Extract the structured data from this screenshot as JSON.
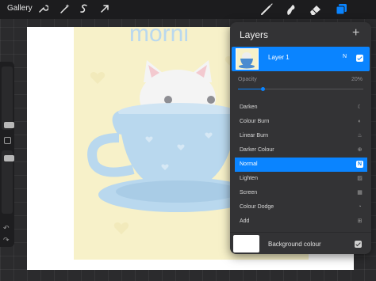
{
  "topbar": {
    "gallery_label": "Gallery",
    "left_tools": [
      "wrench-icon",
      "magic-wand-icon",
      "selection-icon",
      "transform-arrow-icon"
    ],
    "right_tools": [
      "brush-icon",
      "smudge-icon",
      "eraser-icon",
      "layers-icon"
    ],
    "accent_color": "#0a84ff"
  },
  "canvas": {
    "artwork_text": "morni",
    "background_color": "#ffffff",
    "art_background_color": "#f7f1c9"
  },
  "sidebar": {
    "size_slider_level": 0.3,
    "opacity_slider_level": 0.5
  },
  "layers_panel": {
    "title": "Layers",
    "add_icon": "plus-icon",
    "layer": {
      "name": "Layer 1",
      "blend_code": "N",
      "visible": true
    },
    "opacity": {
      "label": "Opacity",
      "value_text": "20%",
      "value": 0.2
    },
    "blend_modes": [
      {
        "label": "Darken",
        "icon": "moon-icon",
        "glyph": "☾",
        "selected": false
      },
      {
        "label": "Colour Burn",
        "icon": "burn-icon",
        "glyph": "◐",
        "selected": false
      },
      {
        "label": "Linear Burn",
        "icon": "flame-icon",
        "glyph": "♨",
        "selected": false
      },
      {
        "label": "Darker Colour",
        "icon": "plus-circle-icon",
        "glyph": "⊕",
        "selected": false
      },
      {
        "label": "Normal",
        "icon": "normal-n-icon",
        "glyph": "N",
        "selected": true
      },
      {
        "label": "Lighten",
        "icon": "hatch-icon",
        "glyph": "▨",
        "selected": false
      },
      {
        "label": "Screen",
        "icon": "screen-icon",
        "glyph": "▦",
        "selected": false
      },
      {
        "label": "Colour Dodge",
        "icon": "dodge-icon",
        "glyph": "◔",
        "selected": false
      },
      {
        "label": "Add",
        "icon": "add-square-icon",
        "glyph": "⊞",
        "selected": false
      }
    ],
    "background": {
      "label": "Background colour",
      "color": "#ffffff",
      "visible": true
    }
  }
}
